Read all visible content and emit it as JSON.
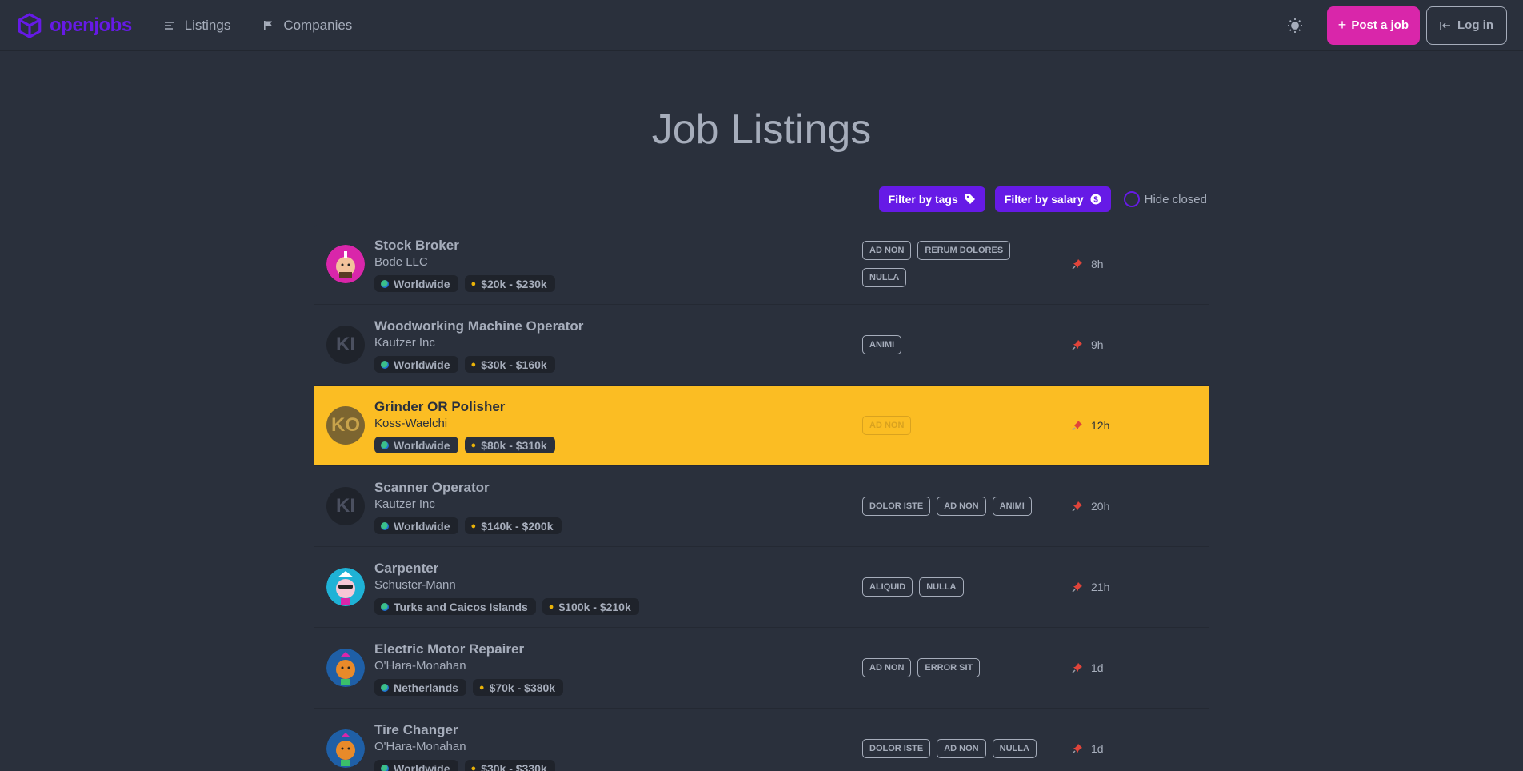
{
  "brand": {
    "name": "openjobs"
  },
  "nav": {
    "listings": "Listings",
    "companies": "Companies"
  },
  "actions": {
    "post": "Post a job",
    "login": "Log in"
  },
  "page": {
    "title": "Job Listings"
  },
  "filters": {
    "tags": "Filter by tags",
    "salary": "Filter by salary",
    "hide_closed": "Hide closed"
  },
  "jobs": [
    {
      "title": "Stock Broker",
      "company": "Bode LLC",
      "location": "Worldwide",
      "salary": "$20k - $230k",
      "tags": [
        "AD NON",
        "RERUM DOLORES",
        "NULLA"
      ],
      "time": "8h",
      "avatar": "illustration",
      "initials": ""
    },
    {
      "title": "Woodworking Machine Operator",
      "company": "Kautzer Inc",
      "location": "Worldwide",
      "salary": "$30k - $160k",
      "tags": [
        "ANIMI"
      ],
      "time": "9h",
      "avatar": "initials",
      "initials": "KI"
    },
    {
      "title": "Grinder OR Polisher",
      "company": "Koss-Waelchi",
      "location": "Worldwide",
      "salary": "$80k - $310k",
      "tags": [
        "AD NON"
      ],
      "time": "12h",
      "avatar": "initials",
      "initials": "KO",
      "highlight": true
    },
    {
      "title": "Scanner Operator",
      "company": "Kautzer Inc",
      "location": "Worldwide",
      "salary": "$140k - $200k",
      "tags": [
        "DOLOR ISTE",
        "AD NON",
        "ANIMI"
      ],
      "time": "20h",
      "avatar": "initials",
      "initials": "KI"
    },
    {
      "title": "Carpenter",
      "company": "Schuster-Mann",
      "location": "Turks and Caicos Islands",
      "salary": "$100k - $210k",
      "tags": [
        "ALIQUID",
        "NULLA"
      ],
      "time": "21h",
      "avatar": "illustration",
      "initials": ""
    },
    {
      "title": "Electric Motor Repairer",
      "company": "O'Hara-Monahan",
      "location": "Netherlands",
      "salary": "$70k - $380k",
      "tags": [
        "AD NON",
        "ERROR SIT"
      ],
      "time": "1d",
      "avatar": "illustration",
      "initials": ""
    },
    {
      "title": "Tire Changer",
      "company": "O'Hara-Monahan",
      "location": "Worldwide",
      "salary": "$30k - $330k",
      "tags": [
        "DOLOR ISTE",
        "AD NON",
        "NULLA"
      ],
      "time": "1d",
      "avatar": "illustration",
      "initials": ""
    }
  ],
  "colors": {
    "primary": "#661ae6",
    "secondary": "#d926aa",
    "accent": "#fbbd23",
    "base": "#2a303c"
  },
  "icons": [
    "cube-logo-icon",
    "listings-icon",
    "flag-icon",
    "sun-icon",
    "plus-icon",
    "login-icon",
    "tag-icon",
    "dollar-icon",
    "globe-icon",
    "money-bag-icon",
    "pin-icon"
  ]
}
